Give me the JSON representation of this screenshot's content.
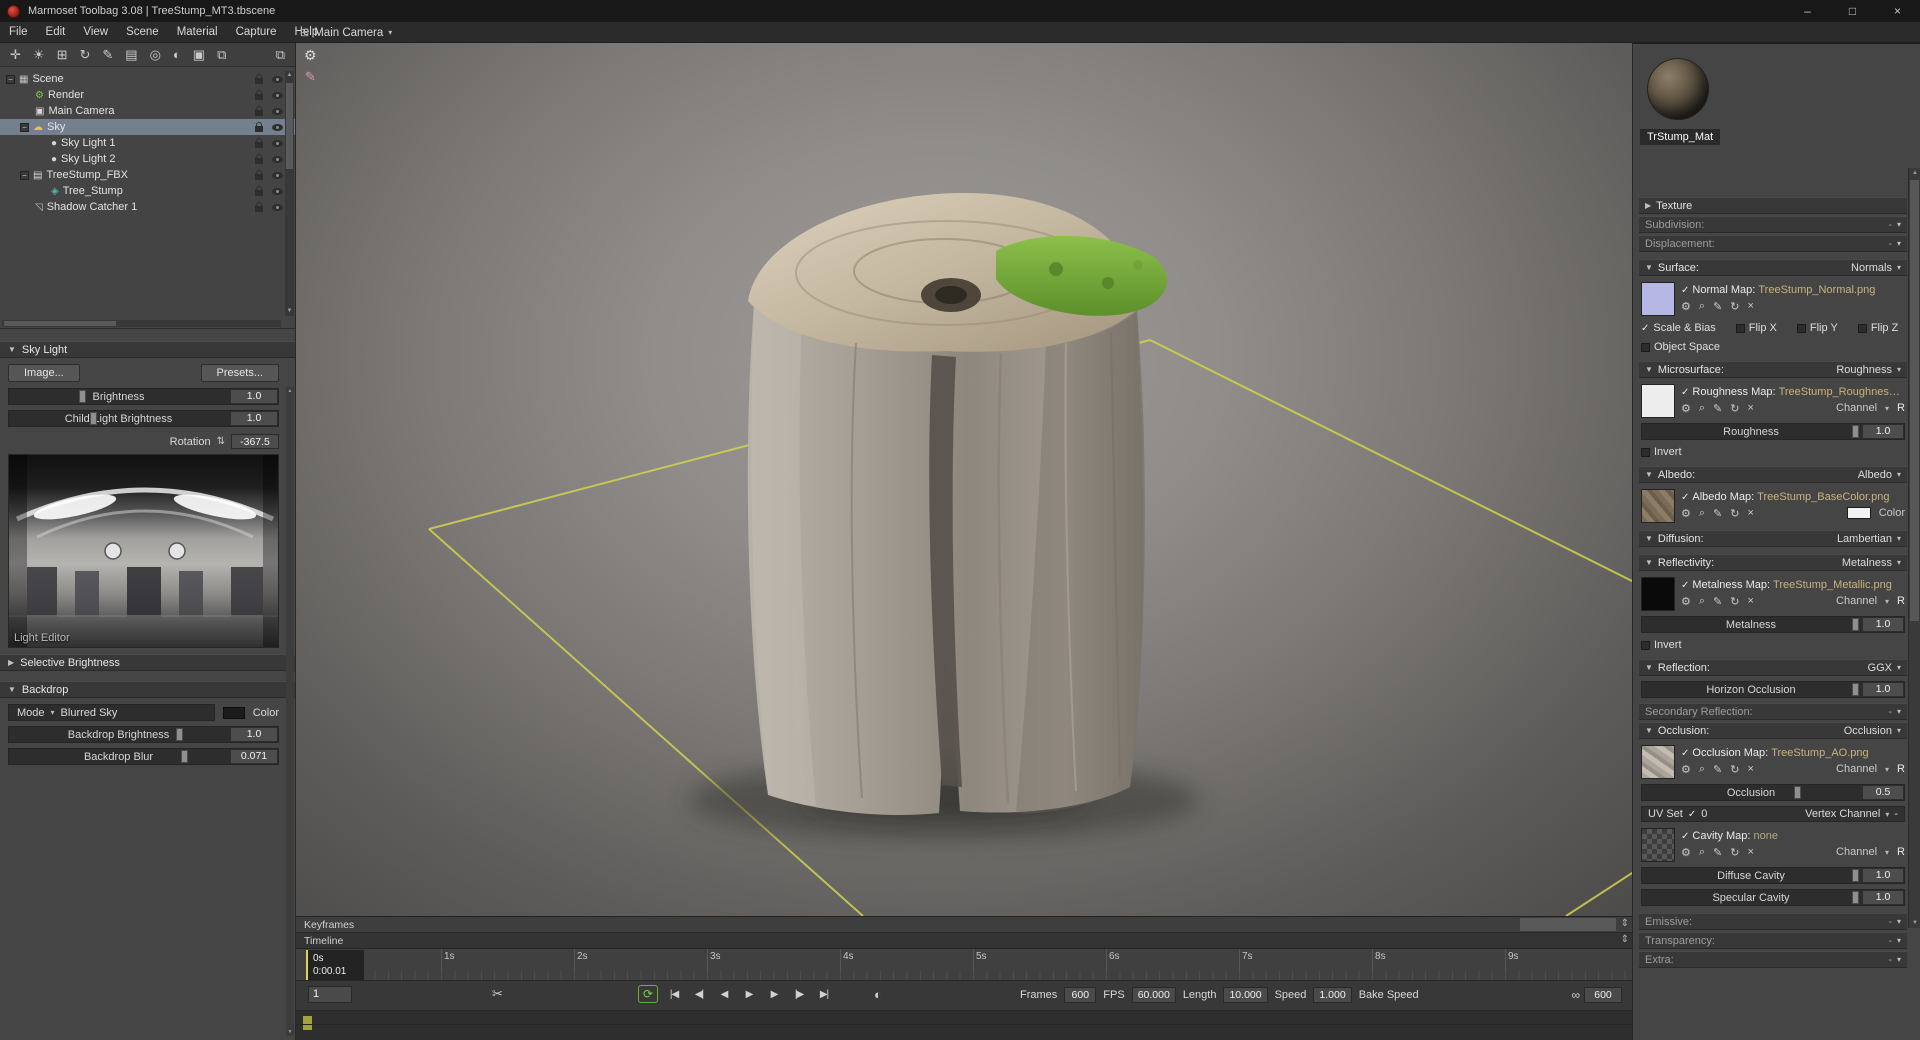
{
  "window": {
    "title": "Marmoset Toolbag 3.08 | TreeStump_MT3.tbscene"
  },
  "menu": [
    "File",
    "Edit",
    "View",
    "Scene",
    "Material",
    "Capture",
    "Help"
  ],
  "viewport": {
    "camera_tab": "Main Camera"
  },
  "scene_tree": {
    "items": [
      {
        "label": "Scene"
      },
      {
        "label": "Render"
      },
      {
        "label": "Main Camera"
      },
      {
        "label": "Sky"
      },
      {
        "label": "Sky Light 1"
      },
      {
        "label": "Sky Light 2"
      },
      {
        "label": "TreeStump_FBX"
      },
      {
        "label": "Tree_Stump"
      },
      {
        "label": "Shadow Catcher 1"
      }
    ]
  },
  "sky_light": {
    "title": "Sky Light",
    "image_button": "Image...",
    "presets_button": "Presets...",
    "brightness_label": "Brightness",
    "brightness_value": "1.0",
    "child_brightness_label": "Child-Light Brightness",
    "child_brightness_value": "1.0",
    "rotation_label": "Rotation",
    "rotation_value": "-367.5",
    "light_editor_label": "Light Editor",
    "selective_brightness_label": "Selective Brightness"
  },
  "backdrop": {
    "title": "Backdrop",
    "mode_label": "Mode",
    "mode_value": "Blurred Sky",
    "color_label": "Color",
    "brightness_label": "Backdrop Brightness",
    "brightness_value": "1.0",
    "blur_label": "Backdrop Blur",
    "blur_value": "0.071"
  },
  "material": {
    "name": "TrStump_Mat",
    "sections": {
      "texture": {
        "label": "Texture"
      },
      "subdivision": {
        "label": "Subdivision:",
        "value": "-"
      },
      "displacement": {
        "label": "Displacement:",
        "value": "-"
      },
      "surface": {
        "label": "Surface:",
        "value": "Normals",
        "map_label": "Normal Map:",
        "map_file": "TreeStump_Normal.png",
        "scale_bias": "Scale & Bias",
        "flip_x": "Flip X",
        "flip_y": "Flip Y",
        "flip_z": "Flip Z",
        "object_space": "Object Space"
      },
      "microsurface": {
        "label": "Microsurface:",
        "value": "Roughness",
        "map_label": "Roughness Map:",
        "map_file": "TreeStump_Roughness.png",
        "channel_label": "Channel",
        "channel_value": "R",
        "slider_label": "Roughness",
        "slider_value": "1.0",
        "invert": "Invert"
      },
      "albedo": {
        "label": "Albedo:",
        "value": "Albedo",
        "map_label": "Albedo Map:",
        "map_file": "TreeStump_BaseColor.png",
        "color_label": "Color"
      },
      "diffusion": {
        "label": "Diffusion:",
        "value": "Lambertian"
      },
      "reflectivity": {
        "label": "Reflectivity:",
        "value": "Metalness",
        "map_label": "Metalness Map:",
        "map_file": "TreeStump_Metallic.png",
        "channel_label": "Channel",
        "channel_value": "R",
        "slider_label": "Metalness",
        "slider_value": "1.0",
        "invert": "Invert"
      },
      "reflection": {
        "label": "Reflection:",
        "value": "GGX",
        "slider_label": "Horizon Occlusion",
        "slider_value": "1.0"
      },
      "secondary_reflection": {
        "label": "Secondary Reflection:",
        "value": "-"
      },
      "occlusion": {
        "label": "Occlusion:",
        "value": "Occlusion",
        "map_label": "Occlusion Map:",
        "map_file": "TreeStump_AO.png",
        "channel_label": "Channel",
        "channel_value": "R",
        "slider_label": "Occlusion",
        "slider_value": "0.5",
        "uv_set_label": "UV Set",
        "uv_set_value": "0",
        "vertex_channel_label": "Vertex Channel",
        "vertex_channel_value": "-",
        "cavity_label": "Cavity Map:",
        "cavity_value": "none",
        "cavity_channel_label": "Channel",
        "cavity_channel_value": "R",
        "diffuse_cavity_label": "Diffuse Cavity",
        "diffuse_cavity_value": "1.0",
        "specular_cavity_label": "Specular Cavity",
        "specular_cavity_value": "1.0"
      },
      "emissive": {
        "label": "Emissive:",
        "value": "-"
      },
      "transparency": {
        "label": "Transparency:",
        "value": "-"
      },
      "extra": {
        "label": "Extra:",
        "value": "-"
      }
    }
  },
  "timeline": {
    "keyframes_label": "Keyframes",
    "timeline_label": "Timeline",
    "ticks": [
      "0s",
      "1s",
      "2s",
      "3s",
      "4s",
      "5s",
      "6s",
      "7s",
      "8s",
      "9s"
    ],
    "playhead_sec": "0s",
    "playhead_time": "0:00.01",
    "frame_value": "1",
    "fields": {
      "frames_label": "Frames",
      "frames_value": "600",
      "fps_label": "FPS",
      "fps_value": "60.000",
      "length_label": "Length",
      "length_value": "10.000",
      "speed_label": "Speed",
      "speed_value": "1.000",
      "bake_speed_label": "Bake Speed",
      "link_value": "600"
    }
  },
  "icons": {
    "minimize": "–",
    "maximize": "□",
    "close": "×",
    "grid": "⊞",
    "caret": "▾",
    "tri-down": "▼",
    "tri-right": "▶",
    "tri-up": "▲",
    "check": "✓",
    "gear": "⚙",
    "magnifier": "⌕",
    "pencil": "✎",
    "refresh": "↻",
    "remove": "×",
    "select": "✛",
    "sun": "☀",
    "hierarchy": "⊞",
    "rotate": "↻",
    "paint": "✎",
    "layers": "▤",
    "camera": "◎",
    "sphere-half": "◐",
    "folder": "▣",
    "copy": "⧉",
    "clipboard": "⧉",
    "cloud": "☁",
    "bulb": "●",
    "page": "▤",
    "mesh": "◈",
    "plane": "◹",
    "cube": "▦",
    "camera-body": "▣",
    "render": "⚙",
    "add": "⊕",
    "spheres": "◉",
    "checker": "▦",
    "trash": "✖",
    "search-sphere": "◍",
    "world": "◐",
    "updown": "⇕",
    "scissors": "✂",
    "loop": "⟳",
    "skip-start": "|◀",
    "prev-key": "◀|",
    "step-back": "◀",
    "play": "▶",
    "step-fwd": "▶",
    "next-key": "|▶",
    "skip-end": "▶|",
    "link": "∞",
    "stepper": "⇅",
    "minus": "−"
  }
}
